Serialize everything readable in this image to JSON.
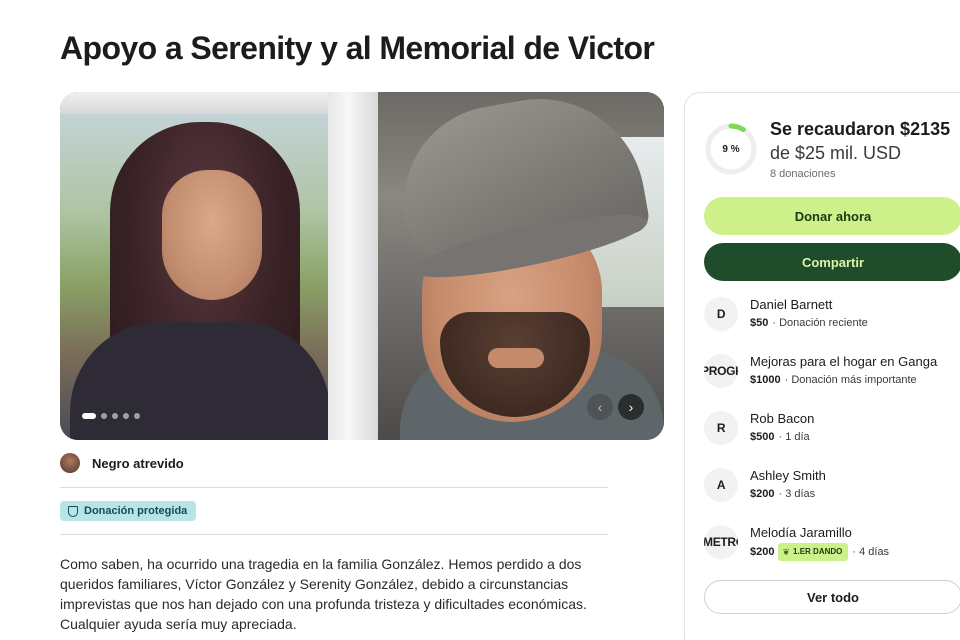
{
  "page": {
    "title": "Apoyo a Serenity y al Memorial de Victor"
  },
  "organizer": {
    "name": "Negro atrevido"
  },
  "badge": {
    "label": "Donación protegida"
  },
  "story": {
    "lines": [
      "Como saben, ha ocurrido una tragedia en la familia González. Hemos perdido a dos",
      "queridos familiares, Víctor González y Serenity González, debido a circunstancias",
      "imprevistas que nos han dejado con una profunda tristeza y dificultades económicas.",
      "Cualquier ayuda sería muy apreciada."
    ]
  },
  "carousel": {
    "prev_icon": "chevron-left-icon",
    "next_icon": "chevron-right-icon",
    "prev_glyph": "‹",
    "next_glyph": "›",
    "total_slides": 5,
    "active_slide": 1
  },
  "fundraiser": {
    "percent_label": "9 %",
    "progress_fraction": 0.09,
    "raised": "Se recaudaron $2135",
    "goal": "de $25 mil. USD",
    "donations_count": "8 donaciones",
    "donate_label": "Donar ahora",
    "share_label": "Compartir",
    "see_all_label": "Ver todo"
  },
  "donors": [
    {
      "avatar": "D",
      "name": "Daniel Barnett",
      "amount": "$50",
      "meta": "· Donación reciente",
      "chip": ""
    },
    {
      "avatar": "PROGRAMO",
      "name": "Mejoras para el hogar en Ganga",
      "amount": "$1000",
      "meta": "· Donación más importante",
      "chip": ""
    },
    {
      "avatar": "R",
      "name": "Rob Bacon",
      "amount": "$500",
      "meta": "· 1 día",
      "chip": ""
    },
    {
      "avatar": "A",
      "name": "Ashley Smith",
      "amount": "$200",
      "meta": "· 3 días",
      "chip": ""
    },
    {
      "avatar": "METRO",
      "name": "Melodía Jaramillo",
      "amount": "$200",
      "meta": "· 4 días",
      "chip": "1.ER DANDO"
    }
  ],
  "colors": {
    "accent_green": "#cdf08a",
    "dark_green": "#1f4d2b",
    "progress_green": "#7ed957",
    "badge_teal": "#b6e5e5"
  }
}
